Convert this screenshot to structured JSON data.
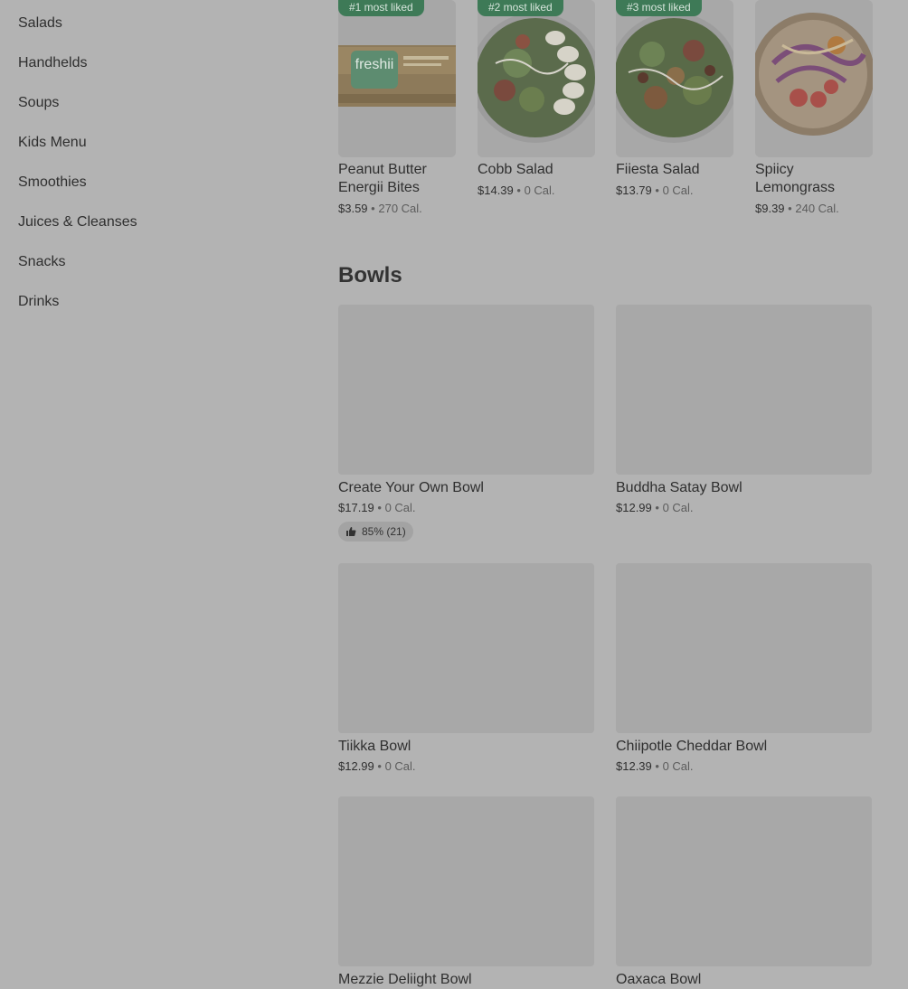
{
  "sidebar": {
    "items": [
      {
        "label": "Salads"
      },
      {
        "label": "Handhelds"
      },
      {
        "label": "Soups"
      },
      {
        "label": "Kids Menu"
      },
      {
        "label": "Smoothies"
      },
      {
        "label": "Juices & Cleanses"
      },
      {
        "label": "Snacks"
      },
      {
        "label": "Drinks"
      }
    ]
  },
  "most_liked": [
    {
      "badge": "#1 most liked",
      "name": "Peanut Butter Energii Bites",
      "price": "$3.59",
      "sep": "•",
      "calories": "270 Cal.",
      "logo_text": "freshii"
    },
    {
      "badge": "#2 most liked",
      "name": "Cobb Salad",
      "price": "$14.39",
      "sep": "•",
      "calories": "0 Cal."
    },
    {
      "badge": "#3 most liked",
      "name": "Fiiesta Salad",
      "price": "$13.79",
      "sep": "•",
      "calories": "0 Cal."
    },
    {
      "badge": "",
      "name": "Spiicy Lemongrass",
      "price": "$9.39",
      "sep": "•",
      "calories": "240 Cal."
    }
  ],
  "bowls": {
    "title": "Bowls",
    "items": [
      {
        "name": "Create Your Own Bowl",
        "price": "$17.19",
        "sep": "•",
        "calories": "0 Cal.",
        "rating": "85% (21)",
        "rating_icon": "thumbs-up-icon"
      },
      {
        "name": "Buddha Satay Bowl",
        "price": "$12.99",
        "sep": "•",
        "calories": "0 Cal."
      },
      {
        "name": "Tiikka Bowl",
        "price": "$12.99",
        "sep": "•",
        "calories": "0 Cal."
      },
      {
        "name": "Chiipotle Cheddar Bowl",
        "price": "$12.39",
        "sep": "•",
        "calories": "0 Cal."
      },
      {
        "name": "Mezzie Deliight Bowl"
      },
      {
        "name": "Oaxaca Bowl"
      }
    ]
  },
  "colors": {
    "overlay_bg": "#b3b3b3",
    "badge_green": "#3e7a57",
    "text_dark": "#2f2f2f"
  }
}
